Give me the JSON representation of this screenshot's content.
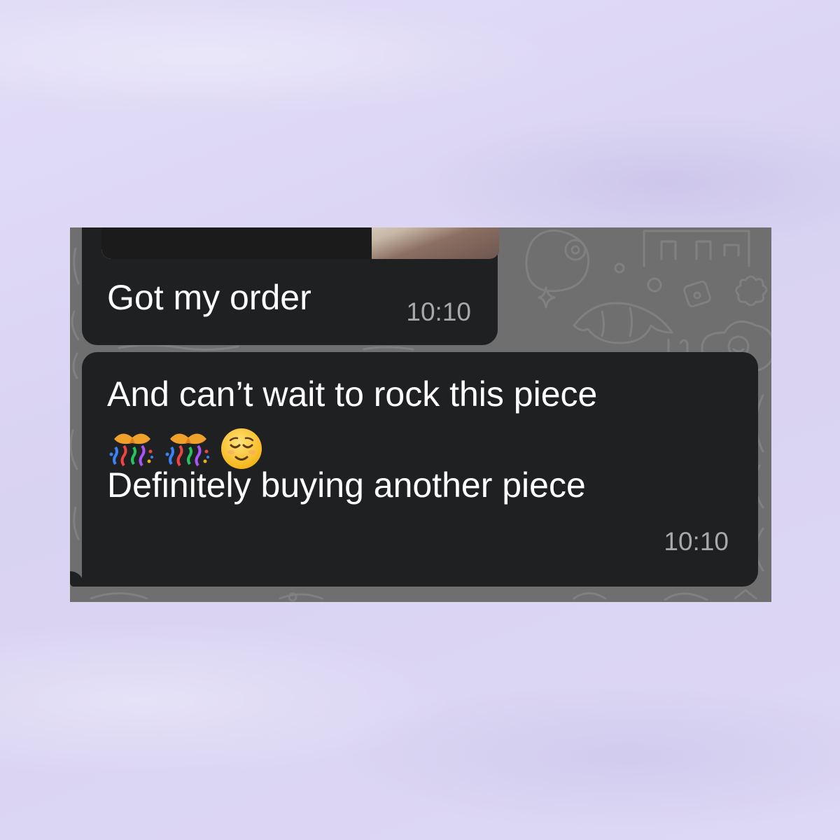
{
  "conversation": {
    "messages": [
      {
        "text": "Got my order",
        "time": "10:10",
        "has_photo": true
      },
      {
        "lines": [
          "And can’t wait to rock this piece",
          "Definitely buying another piece"
        ],
        "emojis": [
          "party-popper-icon",
          "party-popper-icon",
          "relieved-face-icon"
        ],
        "time": "10:10"
      }
    ]
  },
  "colors": {
    "page_background": "#dcd6f3",
    "chat_background": "#6f6f6f",
    "bubble": "#1f2022",
    "message_text": "#ffffff",
    "timestamp": "#a9a9ab"
  }
}
